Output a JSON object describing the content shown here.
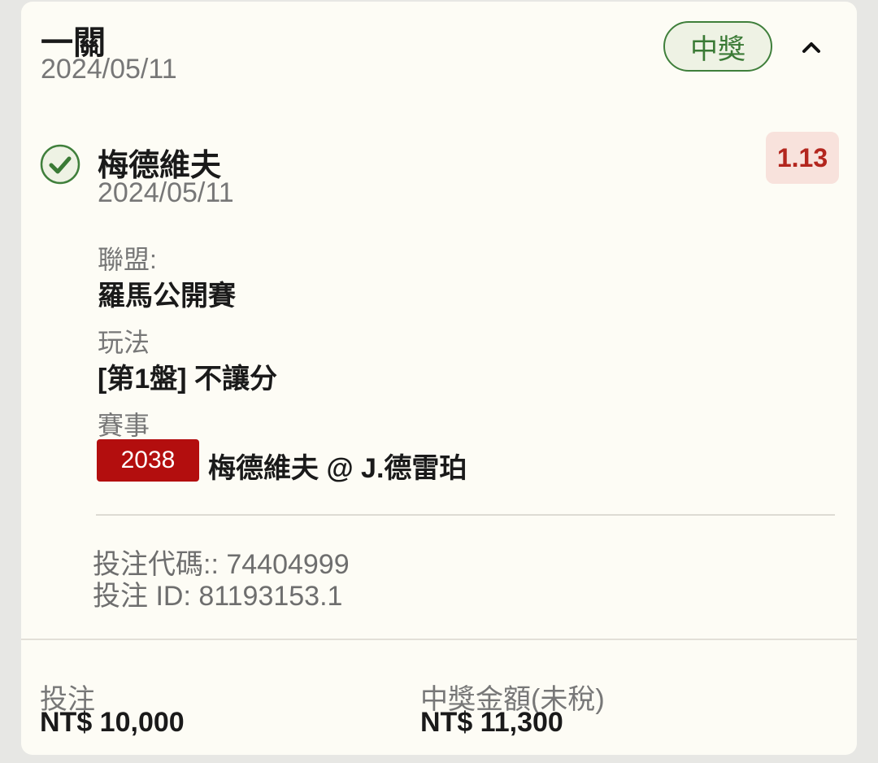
{
  "bet": {
    "type": "一關",
    "date": "2024/05/11",
    "status": "中獎"
  },
  "selection": {
    "name": "梅德維夫",
    "date": "2024/05/11",
    "odds": "1.13",
    "league_label": "聯盟:",
    "league": "羅馬公開賽",
    "market_label": "玩法",
    "market": "[第1盤] 不讓分",
    "event_label": "賽事",
    "event_id": "2038",
    "event_name": "梅德維夫 @ J.德雷珀"
  },
  "codes": {
    "bet_code": "投注代碼:: 74404999",
    "bet_id": "投注 ID: 81193153.1"
  },
  "footer": {
    "stake_label": "投注",
    "stake": "NT$ 10,000",
    "payout_label": "中獎金額(未稅)",
    "payout": "NT$ 11,300"
  },
  "colors": {
    "win_green": "#3a7a35",
    "odds_red": "#b3261e",
    "event_badge": "#b30e0e"
  },
  "icons": {
    "check": "check-circle-icon",
    "collapse": "chevron-up-icon"
  }
}
